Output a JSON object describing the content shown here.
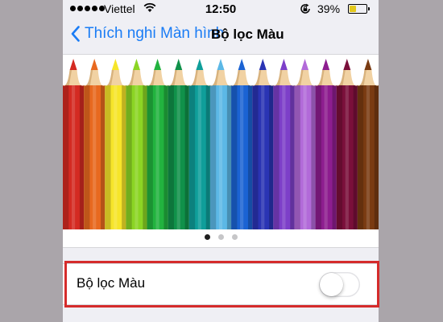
{
  "status_bar": {
    "carrier": "Viettel",
    "time": "12:50",
    "battery_percent": "39%",
    "battery_level": 0.39,
    "battery_color": "#e3c81c",
    "icons": [
      "signal-dots-icon",
      "wifi-icon",
      "rotation-lock-icon",
      "battery-icon"
    ]
  },
  "nav": {
    "back_label": "Thích nghi Màn hình",
    "title": "Bộ lọc Màu",
    "accent_color": "#1a7cf5"
  },
  "preview": {
    "pencil_colors": [
      "#d42a22",
      "#e8691f",
      "#f6e52a",
      "#8bd524",
      "#22b33f",
      "#10914a",
      "#0f9e9a",
      "#5cb8e6",
      "#1b63d3",
      "#2a34b4",
      "#7d3fc9",
      "#b26ad9",
      "#8d1d8f",
      "#7a0f3a",
      "#7a3b12"
    ],
    "page_count": 3,
    "active_page": 0
  },
  "setting": {
    "label": "Bộ lọc Màu",
    "toggle_on": false
  },
  "highlight_color": "#d52b2b"
}
